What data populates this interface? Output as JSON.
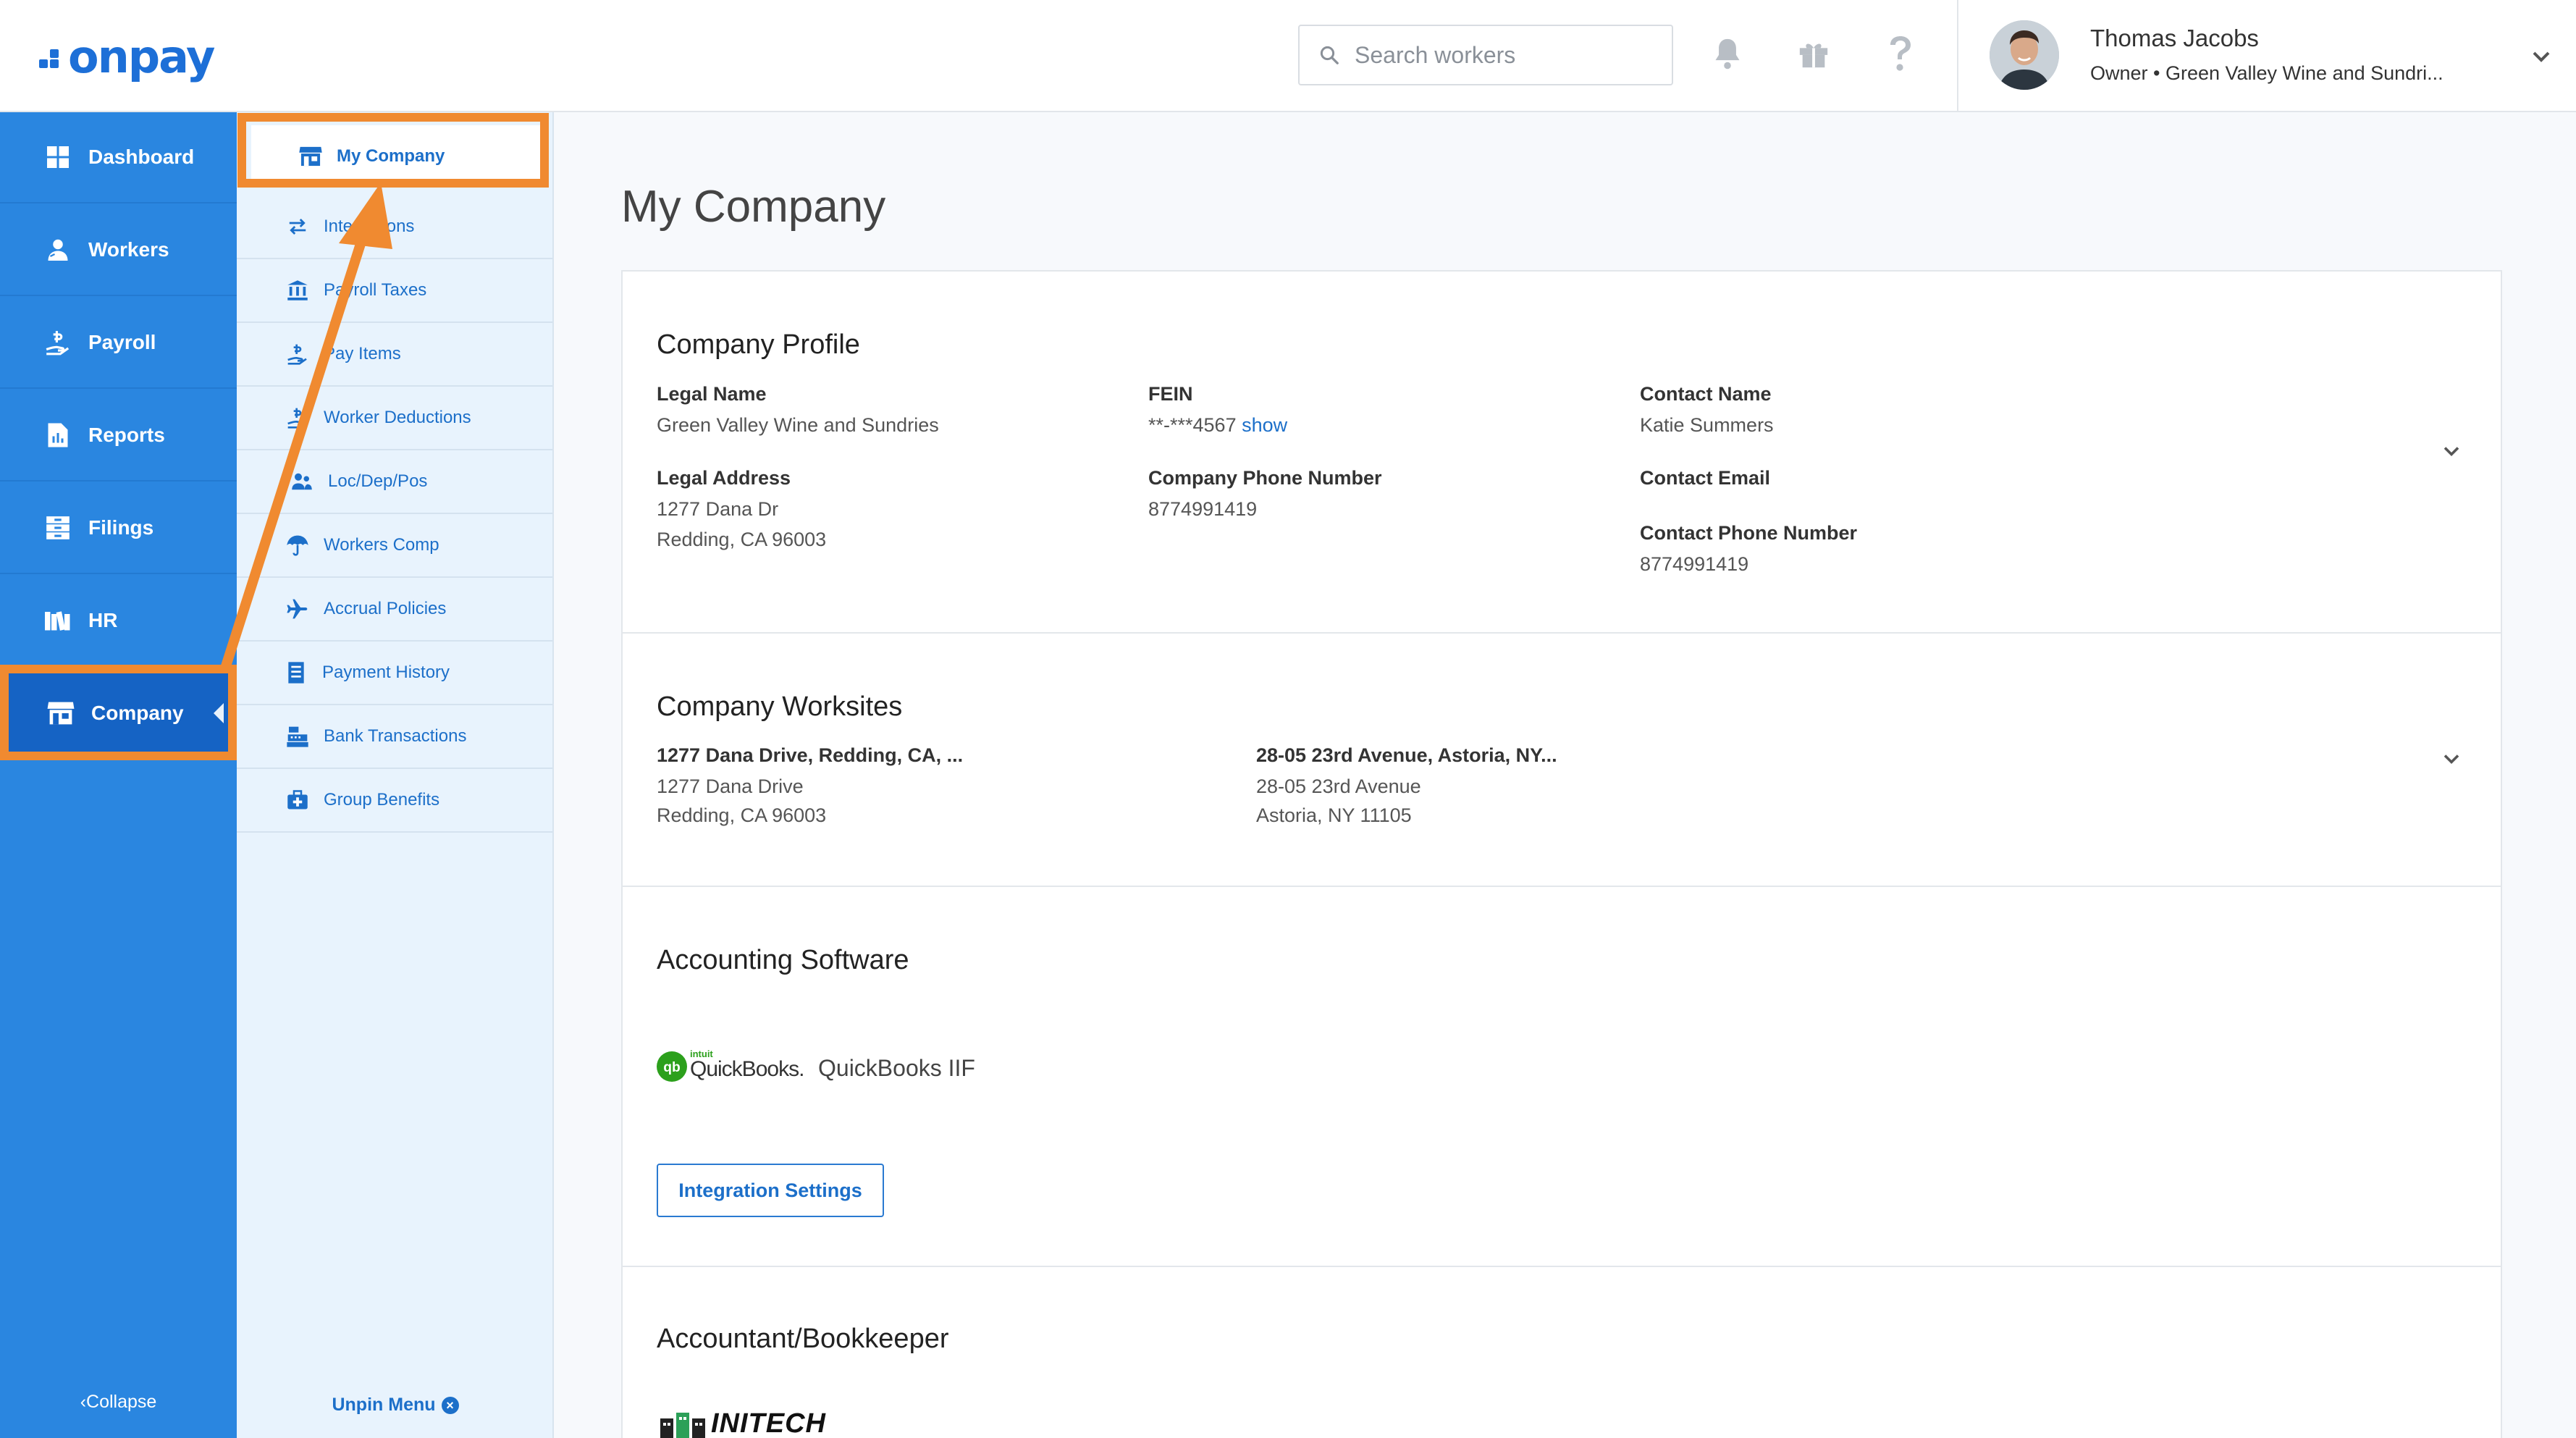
{
  "app": {
    "logo": "onpay"
  },
  "search": {
    "placeholder": "Search workers"
  },
  "user": {
    "name": "Thomas Jacobs",
    "subtitle": "Owner • Green Valley Wine and Sundri..."
  },
  "nav": {
    "items": [
      {
        "label": "Dashboard",
        "icon": "dashboard-icon"
      },
      {
        "label": "Workers",
        "icon": "workers-icon"
      },
      {
        "label": "Payroll",
        "icon": "payroll-icon"
      },
      {
        "label": "Reports",
        "icon": "reports-icon"
      },
      {
        "label": "Filings",
        "icon": "filings-icon"
      },
      {
        "label": "HR",
        "icon": "hr-icon"
      },
      {
        "label": "Company",
        "icon": "store-icon"
      }
    ],
    "collapse_label": "Collapse"
  },
  "subnav": {
    "items": [
      {
        "label": "My Company",
        "icon": "store-icon"
      },
      {
        "label": "Integrations",
        "icon": "swap-arrows-icon"
      },
      {
        "label": "Payroll Taxes",
        "icon": "bank-icon"
      },
      {
        "label": "Pay Items",
        "icon": "payroll-icon"
      },
      {
        "label": "Worker Deductions",
        "icon": "payroll-icon"
      },
      {
        "label": "Loc/Dep/Pos",
        "icon": "people-icon"
      },
      {
        "label": "Workers Comp",
        "icon": "umbrella-icon"
      },
      {
        "label": "Accrual Policies",
        "icon": "plane-icon"
      },
      {
        "label": "Payment History",
        "icon": "list-icon"
      },
      {
        "label": "Bank Transactions",
        "icon": "cash-register-icon"
      },
      {
        "label": "Group Benefits",
        "icon": "medical-kit-icon"
      }
    ],
    "unpin_label": "Unpin Menu"
  },
  "main": {
    "title": "My Company",
    "profile": {
      "title": "Company Profile",
      "legal_name_label": "Legal Name",
      "legal_name": "Green Valley Wine and Sundries",
      "fein_label": "FEIN",
      "fein": "**-***4567",
      "fein_show": "show",
      "contact_name_label": "Contact Name",
      "contact_name": "Katie Summers",
      "legal_address_label": "Legal Address",
      "legal_address_1": "1277 Dana Dr",
      "legal_address_2": "Redding, CA 96003",
      "phone_label": "Company Phone Number",
      "phone": "8774991419",
      "contact_email_label": "Contact Email",
      "contact_phone_label": "Contact Phone Number",
      "contact_phone": "8774991419"
    },
    "worksites": {
      "title": "Company Worksites",
      "sites": [
        {
          "name": "1277 Dana Drive, Redding, CA, ...",
          "line1": "1277 Dana Drive",
          "line2": "Redding, CA 96003"
        },
        {
          "name": "28-05 23rd Avenue, Astoria, NY...",
          "line1": "28-05 23rd Avenue",
          "line2": "Astoria, NY 11105"
        }
      ]
    },
    "accounting": {
      "title": "Accounting Software",
      "logo_small": "intuit",
      "logo_text": "QuickBooks.",
      "software": "QuickBooks IIF",
      "button": "Integration Settings"
    },
    "accountant": {
      "title": "Accountant/Bookkeeper",
      "logo_text": "INITECH"
    }
  },
  "colors": {
    "primary": "#2a86e0",
    "subnav_bg": "#e8f3fd",
    "accent": "#1c6fc9",
    "annotation": "#f08a30"
  }
}
